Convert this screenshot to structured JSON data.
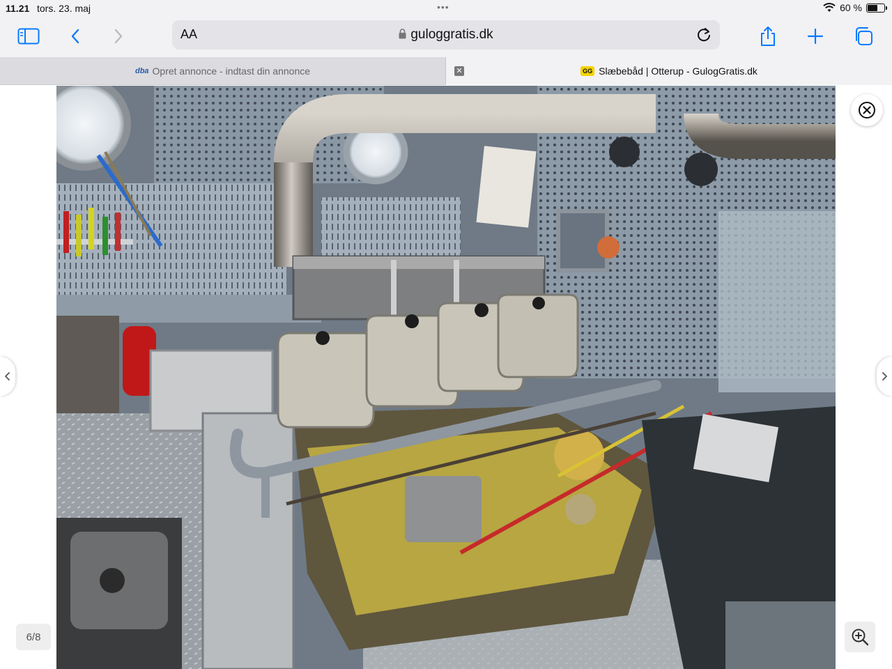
{
  "status_bar": {
    "time": "11.21",
    "date": "tors. 23. maj",
    "battery_text": "60 %",
    "battery_level": 0.6
  },
  "toolbar": {
    "text_size_label": "AA",
    "url": "guloggratis.dk"
  },
  "tabs": [
    {
      "favicon": "dba",
      "title": "Opret annonce - indtast din annonce",
      "active": false
    },
    {
      "favicon": "GG",
      "title": "Slæbebåd | Otterup - GulogGratis.dk",
      "active": true
    }
  ],
  "viewer": {
    "counter": "6/8"
  },
  "icons": {
    "sidebar": "sidebar-icon",
    "back": "chevron-left-icon",
    "forward": "chevron-right-icon",
    "share": "share-icon",
    "new_tab": "plus-icon",
    "tabs": "tabs-icon",
    "close": "close-icon",
    "zoom": "zoom-in-icon"
  },
  "colors": {
    "accent": "#0a7aff",
    "chrome_bg": "#f2f2f4"
  }
}
